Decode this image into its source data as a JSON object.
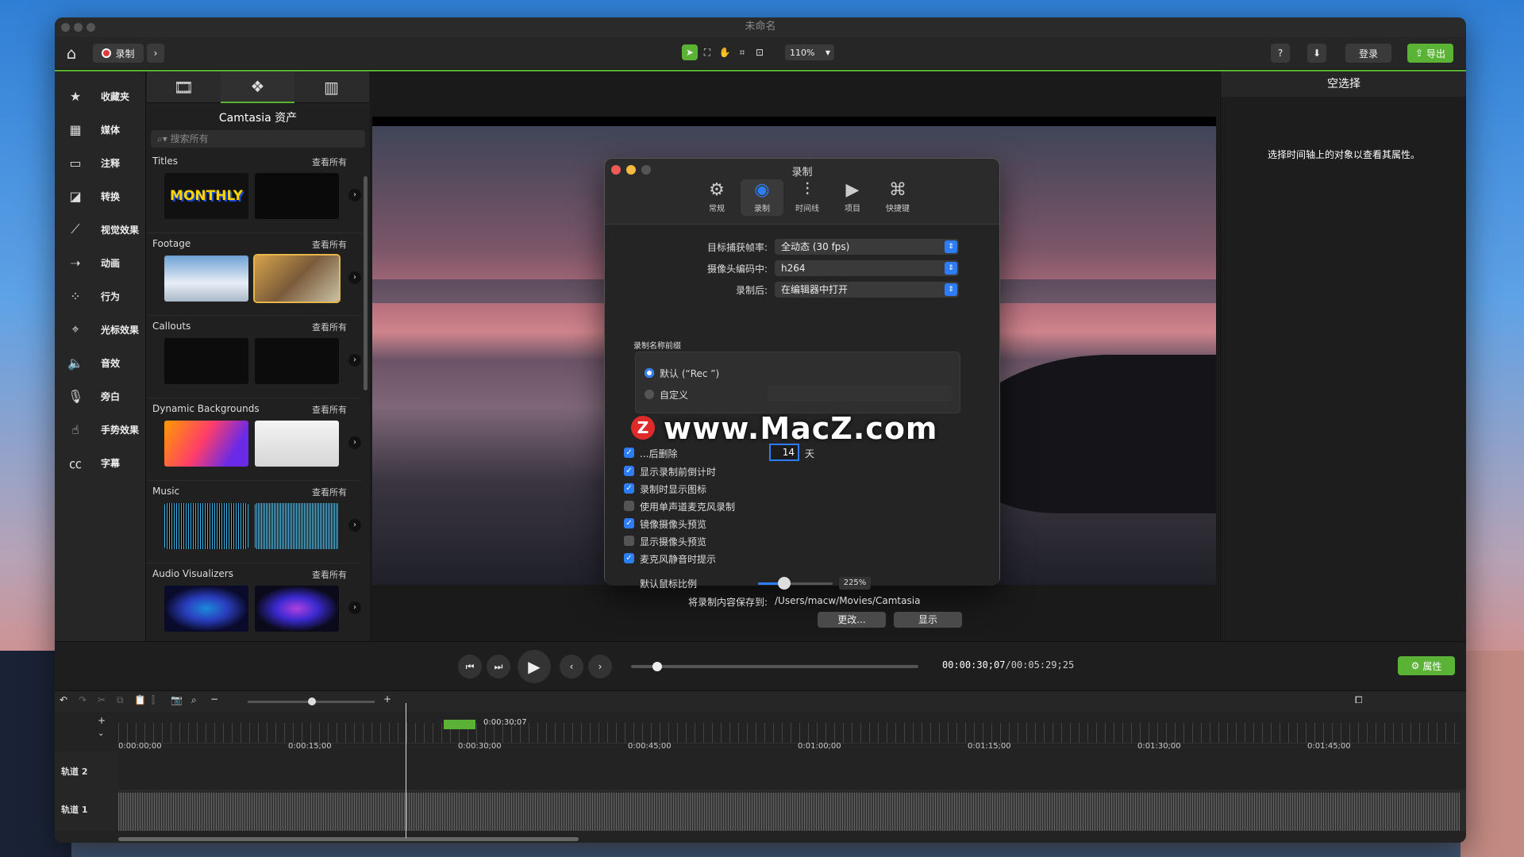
{
  "window": {
    "title": "未命名"
  },
  "toolbar": {
    "record_label": "录制",
    "zoom": "110%",
    "help": "?",
    "login": "登录",
    "export": "导出"
  },
  "leftnav": [
    {
      "label": "收藏夹",
      "icon": "star-icon"
    },
    {
      "label": "媒体",
      "icon": "film-icon"
    },
    {
      "label": "注释",
      "icon": "annotation-icon"
    },
    {
      "label": "转换",
      "icon": "transition-icon"
    },
    {
      "label": "视觉效果",
      "icon": "wand-icon"
    },
    {
      "label": "动画",
      "icon": "animation-arrow-icon"
    },
    {
      "label": "行为",
      "icon": "behavior-icon"
    },
    {
      "label": "光标效果",
      "icon": "cursor-icon"
    },
    {
      "label": "音效",
      "icon": "speaker-icon"
    },
    {
      "label": "旁白",
      "icon": "microphone-icon"
    },
    {
      "label": "手势效果",
      "icon": "hand-gesture-icon"
    },
    {
      "label": "字幕",
      "icon": "cc-icon"
    }
  ],
  "assets": {
    "title": "Camtasia 资产",
    "search_placeholder": "搜索所有",
    "view_all": "查看所有",
    "categories": [
      "Titles",
      "Footage",
      "Callouts",
      "Dynamic Backgrounds",
      "Music",
      "Audio Visualizers"
    ],
    "title_thumb": "MONTHLY"
  },
  "inspector": {
    "title": "空选择",
    "message": "选择时间轴上的对象以查看其属性。",
    "properties_button": "属性"
  },
  "playback": {
    "time_current": "00:00:30;07",
    "time_total": "00:05:29;25",
    "position": 0.09
  },
  "timeline": {
    "playhead_label": "0:00:30;07",
    "ruler": [
      "0:00:00;00",
      "0:00:15;00",
      "0:00:30;00",
      "0:00:45;00",
      "0:01:00;00",
      "0:01:15;00",
      "0:01:30;00",
      "0:01:45;00"
    ],
    "tracks": [
      "轨道 2",
      "轨道 1"
    ]
  },
  "dialog": {
    "title": "录制",
    "tabs": [
      "常规",
      "录制",
      "时间线",
      "项目",
      "快捷键"
    ],
    "frame_rate_label": "目标捕获帧率:",
    "frame_rate_value": "全动态 (30 fps)",
    "camera_codec_label": "摄像头编码中:",
    "camera_codec_value": "h264",
    "after_label": "录制后:",
    "after_value": "在编辑器中打开",
    "prefix_group": "录制名称前缀",
    "prefix_default": "默认 (“Rec ”)",
    "prefix_custom": "自定义",
    "delete_after": "...后删除",
    "delete_days": "14",
    "days_unit": "天",
    "checkboxes": [
      {
        "label": "显示录制前倒计时",
        "checked": true
      },
      {
        "label": "录制时显示图标",
        "checked": true
      },
      {
        "label": "使用单声道麦克风录制",
        "checked": false
      },
      {
        "label": "镜像摄像头预览",
        "checked": true
      },
      {
        "label": "显示摄像头预览",
        "checked": false
      },
      {
        "label": "麦克风静音时提示",
        "checked": true
      }
    ],
    "cursor_scale_label": "默认鼠标比例",
    "cursor_scale_value": "225%",
    "cursor_scale_fraction": 0.35,
    "save_label": "将录制内容保存到:",
    "save_path": "/Users/macw/Movies/Camtasia",
    "change_button": "更改...",
    "show_button": "显示"
  },
  "watermark": {
    "text": "www.MacZ.com",
    "logo": "Z"
  }
}
